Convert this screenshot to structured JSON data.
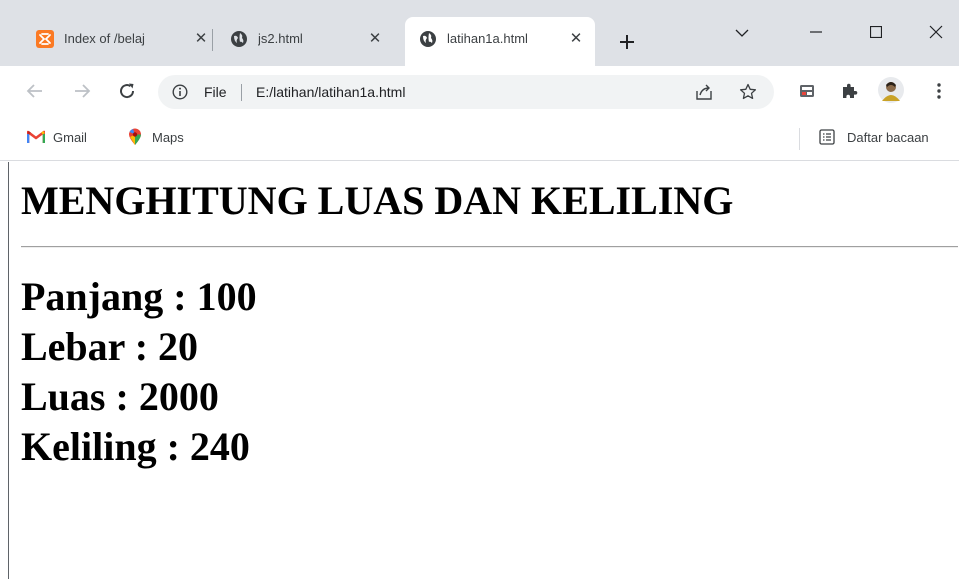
{
  "tabs": [
    {
      "title": "Index of /belaj",
      "active": false
    },
    {
      "title": "js2.html",
      "active": false
    },
    {
      "title": "latihan1a.html",
      "active": true
    }
  ],
  "address_bar": {
    "scheme_label": "File",
    "url": "E:/latihan/latihan1a.html"
  },
  "bookmarks": [
    {
      "label": "Gmail",
      "icon": "gmail-icon"
    },
    {
      "label": "Maps",
      "icon": "maps-icon"
    }
  ],
  "reading_list": {
    "label": "Daftar bacaan"
  },
  "page": {
    "heading": "MENGHITUNG LUAS DAN KELILING",
    "lines": [
      "Panjang : 100",
      "Lebar : 20",
      "Luas : 2000",
      "Keliling : 240"
    ]
  },
  "colors": {
    "tabstrip": "#dee1e6",
    "omnibox": "#f1f3f4",
    "xampp_orange": "#fb7a24"
  }
}
